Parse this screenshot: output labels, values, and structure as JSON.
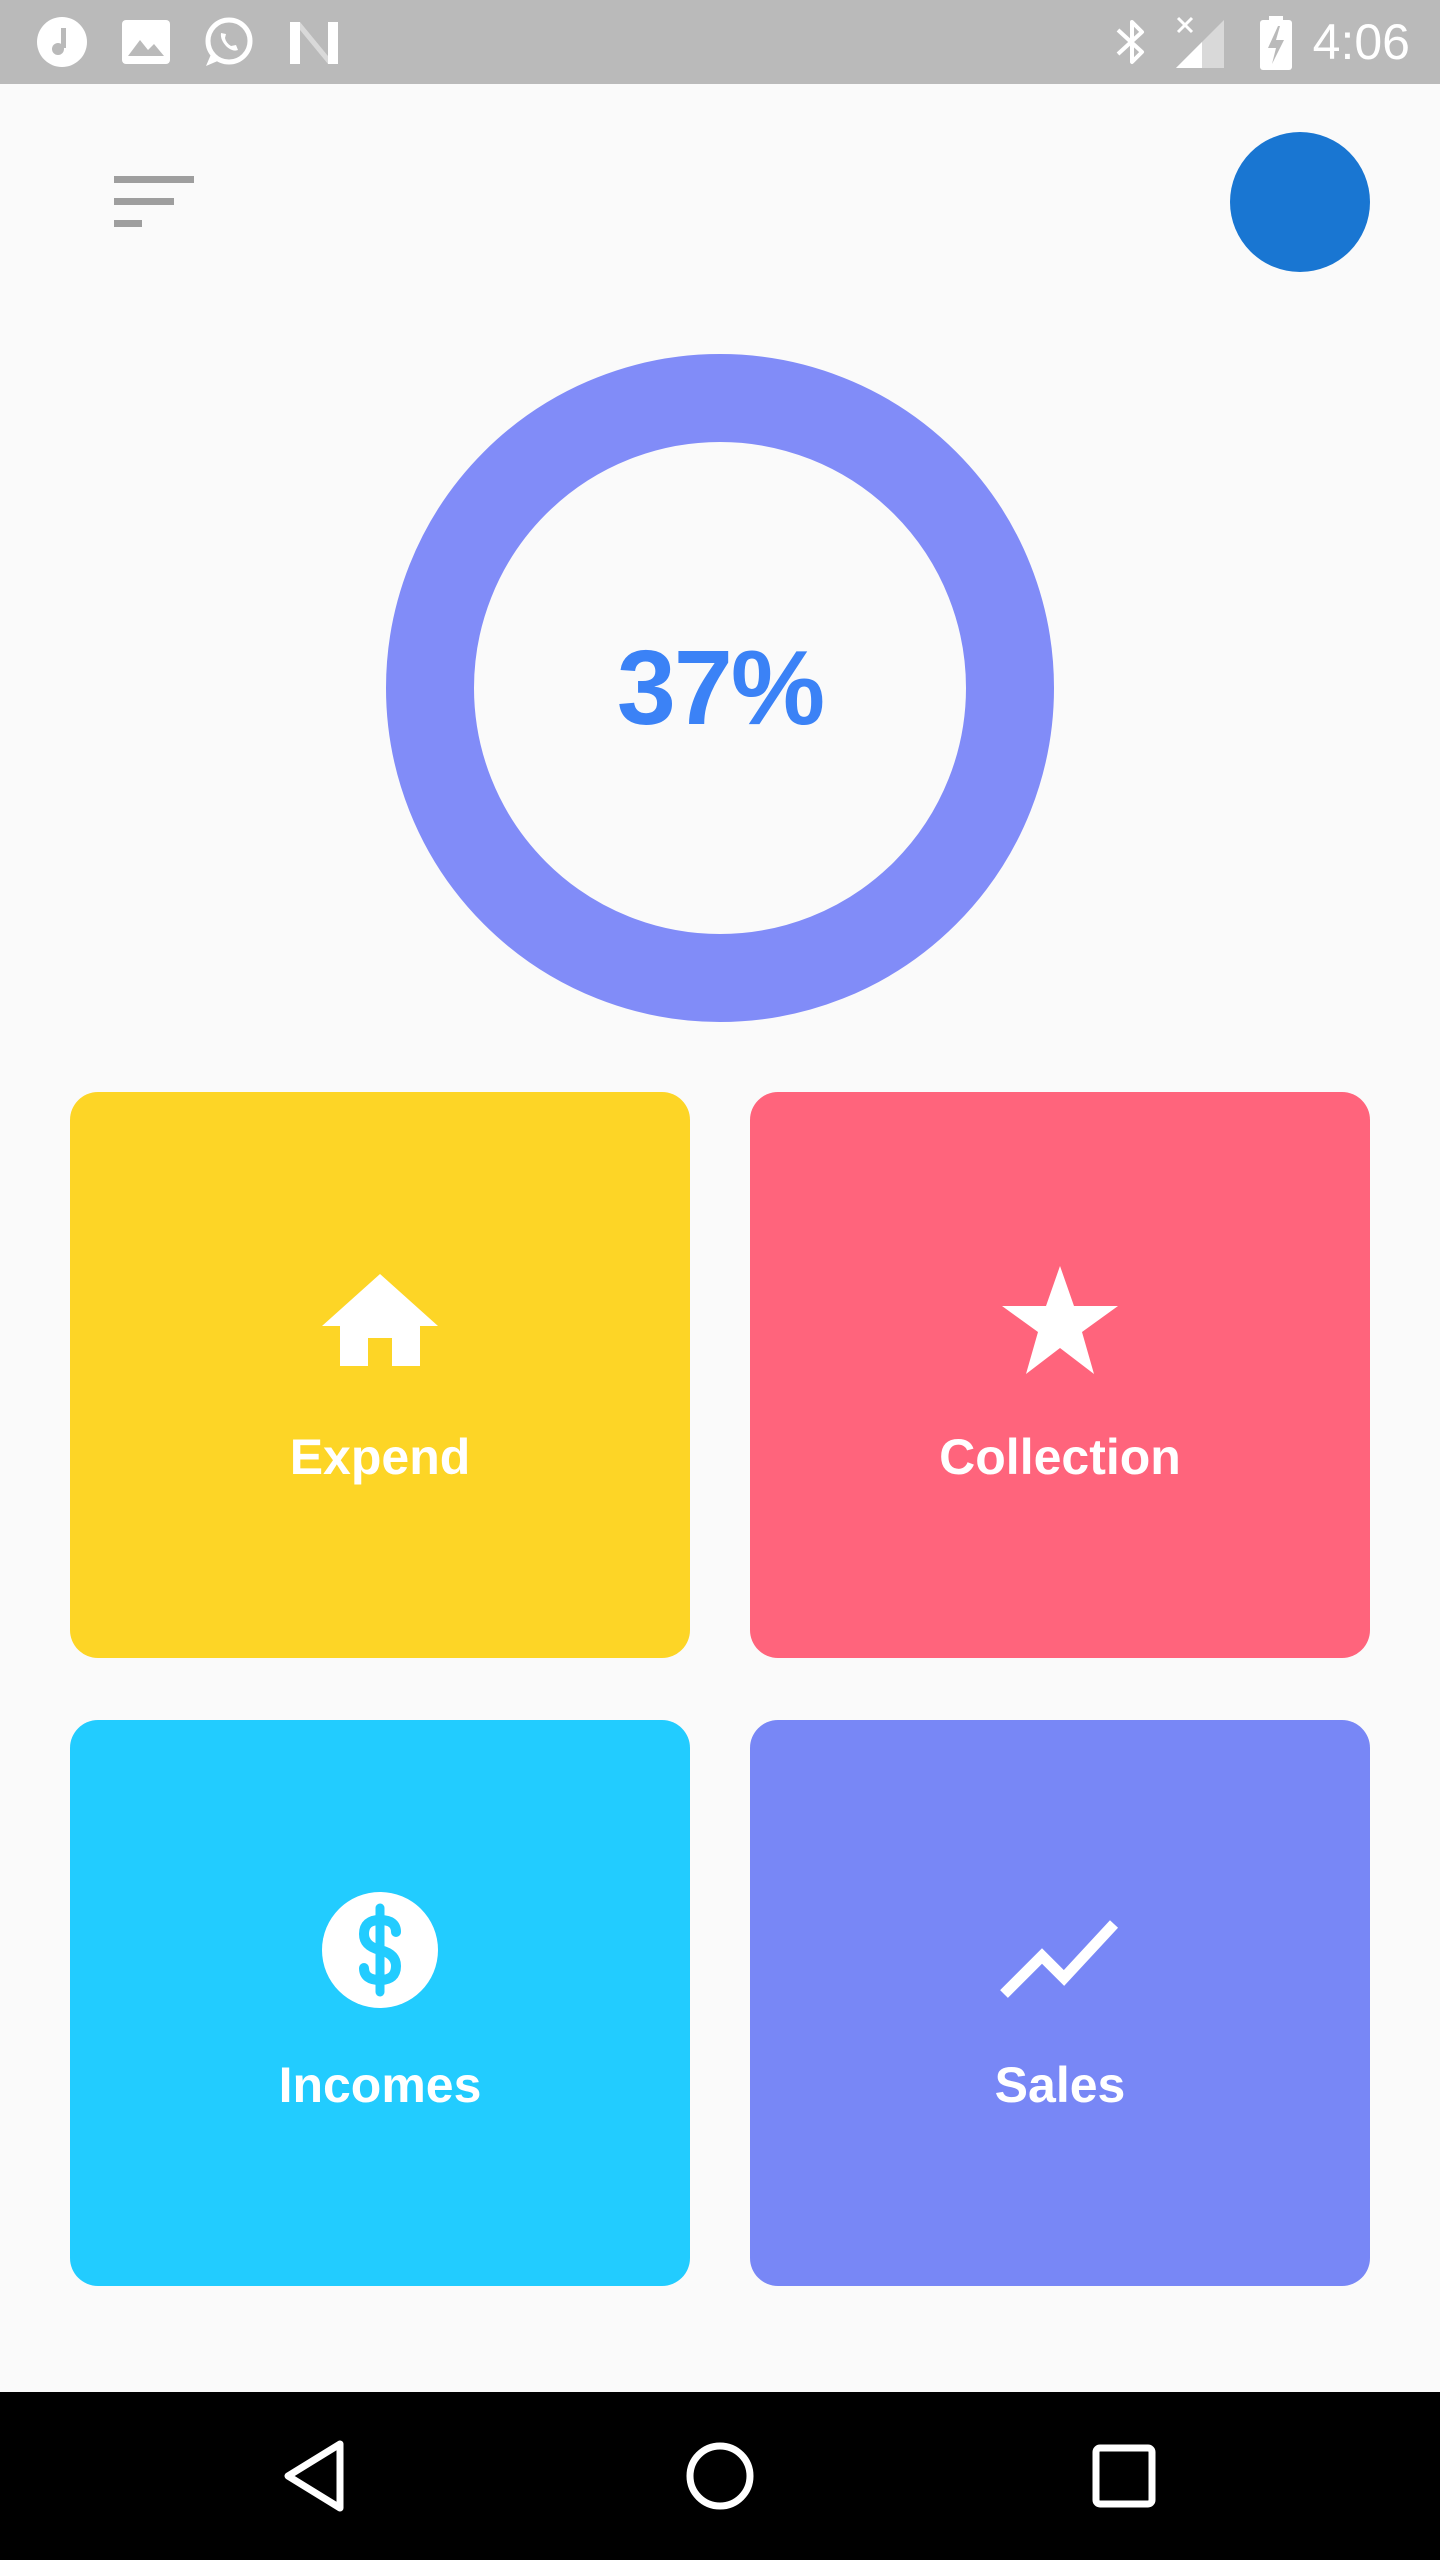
{
  "status_bar": {
    "time": "4:06",
    "left_icons": [
      "music-note-icon",
      "image-icon",
      "whatsapp-icon",
      "n-notification-icon"
    ],
    "right_icons": [
      "bluetooth-icon",
      "signal-no-sim-icon",
      "battery-charging-icon"
    ],
    "background": "#bababa"
  },
  "header": {
    "menu_icon": "sort-menu-icon",
    "avatar_color": "#1976d2"
  },
  "progress": {
    "label": "37%",
    "value": 0.37,
    "ring_color": "#818cf8",
    "label_color": "#3b82f6"
  },
  "tiles": [
    {
      "label": "Expend",
      "icon": "home-icon",
      "color": "#fdd526"
    },
    {
      "label": "Collection",
      "icon": "star-icon",
      "color": "#ff647c"
    },
    {
      "label": "Incomes",
      "icon": "dollar-circle-icon",
      "color": "#22ccff"
    },
    {
      "label": "Sales",
      "icon": "trending-line-icon",
      "color": "#7887f6"
    }
  ],
  "nav_bar": {
    "buttons": [
      "back-triangle-icon",
      "home-circle-icon",
      "recents-square-icon"
    ]
  }
}
